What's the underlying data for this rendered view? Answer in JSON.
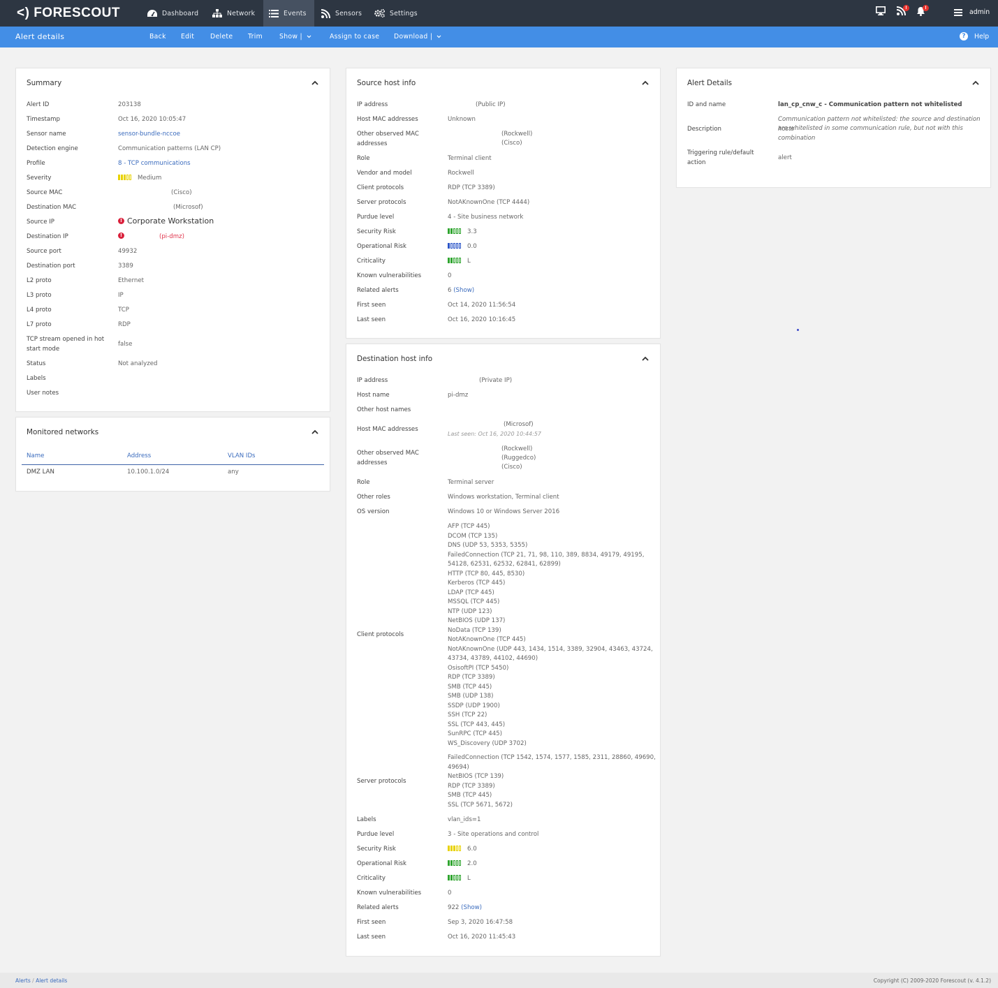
{
  "header": {
    "logo": "<) FORESCOUT",
    "nav": [
      {
        "label": "Dashboard",
        "icon": "dashboard-icon"
      },
      {
        "label": "Network",
        "icon": "network-icon"
      },
      {
        "label": "Events",
        "icon": "events-icon",
        "active": true
      },
      {
        "label": "Sensors",
        "icon": "sensors-icon"
      },
      {
        "label": "Settings",
        "icon": "settings-icon"
      }
    ],
    "user": "admin",
    "badge_1": "!",
    "badge_2": "!"
  },
  "toolbar": {
    "title": "Alert details",
    "back": "Back",
    "edit": "Edit",
    "delete": "Delete",
    "trim": "Trim",
    "show": "Show |",
    "assign": "Assign to case",
    "download": "Download |",
    "help": "Help"
  },
  "summary": {
    "title": "Summary",
    "rows": [
      {
        "label": "Alert ID",
        "value": "203138"
      },
      {
        "label": "Timestamp",
        "value": "Oct 16, 2020 10:05:47"
      },
      {
        "label": "Sensor name",
        "value": "sensor-bundle-nccoe"
      },
      {
        "label": "Detection engine",
        "value": "Communication patterns (LAN CP)"
      },
      {
        "label": "Profile",
        "value": "8 - TCP communications"
      },
      {
        "label": "Severity",
        "value": "Medium"
      },
      {
        "label": "Source MAC",
        "value": "(Cisco)"
      },
      {
        "label": "Destination MAC",
        "value": "(Microsof)"
      },
      {
        "label": "Source IP",
        "value": "Corporate Workstation"
      },
      {
        "label": "Destination IP",
        "value": "(pi-dmz)"
      },
      {
        "label": "Source port",
        "value": "49932"
      },
      {
        "label": "Destination port",
        "value": "3389"
      },
      {
        "label": "L2 proto",
        "value": "Ethernet"
      },
      {
        "label": "L3 proto",
        "value": "IP"
      },
      {
        "label": "L4 proto",
        "value": "TCP"
      },
      {
        "label": "L7 proto",
        "value": "RDP"
      },
      {
        "label": "TCP stream opened in hot start mode",
        "value": "false"
      },
      {
        "label": "Status",
        "value": "Not analyzed"
      },
      {
        "label": "Labels",
        "value": ""
      },
      {
        "label": "User notes",
        "value": ""
      }
    ]
  },
  "monitored": {
    "title": "Monitored networks",
    "col_name": "Name",
    "col_address": "Address",
    "col_vlan": "VLAN IDs",
    "rows": [
      {
        "name": "DMZ LAN",
        "address": "10.100.1.0/24",
        "vlan": "any"
      }
    ]
  },
  "source": {
    "title": "Source host info",
    "rows": [
      {
        "label": "IP address",
        "value": "(Public IP)"
      },
      {
        "label": "Host MAC addresses",
        "value": "Unknown"
      },
      {
        "label": "Other observed MAC addresses",
        "value": "(Rockwell)",
        "value2": "(Cisco)"
      },
      {
        "label": "Role",
        "value": "Terminal client"
      },
      {
        "label": "Vendor and model",
        "value": "Rockwell"
      },
      {
        "label": "Client protocols",
        "value": "RDP (TCP 3389)"
      },
      {
        "label": "Server protocols",
        "value": "NotAKnownOne (TCP 4444)"
      },
      {
        "label": "Purdue level",
        "value": "4 - Site business network"
      },
      {
        "label": "Security Risk",
        "value": "3.3"
      },
      {
        "label": "Operational Risk",
        "value": "0.0"
      },
      {
        "label": "Criticality",
        "value": "L"
      },
      {
        "label": "Known vulnerabilities",
        "value": "0"
      },
      {
        "label": "Related alerts",
        "value": "6",
        "link": "(Show)"
      },
      {
        "label": "First seen",
        "value": "Oct 14, 2020 11:56:54"
      },
      {
        "label": "Last seen",
        "value": "Oct 16, 2020 10:16:45"
      }
    ]
  },
  "destination": {
    "title": "Destination host info",
    "rows": [
      {
        "label": "IP address",
        "value": "(Private IP)"
      },
      {
        "label": "Host name",
        "value": "pi-dmz"
      },
      {
        "label": "Other host names",
        "value": ""
      },
      {
        "label": "Host MAC addresses",
        "value": "(Microsof)",
        "note": "Last seen: Oct 16, 2020 10:44:57"
      },
      {
        "label": "Other observed MAC addresses",
        "lines": [
          "(Rockwell)",
          "(Ruggedco)",
          "(Cisco)"
        ]
      },
      {
        "label": "Role",
        "value": "Terminal server"
      },
      {
        "label": "Other roles",
        "value": "Windows workstation, Terminal client"
      },
      {
        "label": "OS version",
        "value": "Windows 10 or Windows Server 2016"
      },
      {
        "label": "Client protocols",
        "lines": [
          "AFP (TCP 445)",
          "DCOM (TCP 135)",
          "DNS (UDP 53, 5353, 5355)",
          "FailedConnection (TCP 21, 71, 98, 110, 389, 8834, 49179, 49195,",
          "54128, 62531, 62532, 62841, 62899)",
          "HTTP (TCP 80, 445, 8530)",
          "Kerberos (TCP 445)",
          "LDAP (TCP 445)",
          "MSSQL (TCP 445)",
          "NTP (UDP 123)",
          "NetBIOS (UDP 137)",
          "NoData (TCP 139)",
          "NotAKnownOne (TCP 445)",
          "NotAKnownOne (UDP 443, 1434, 1514, 3389, 32904, 43463, 43724,",
          "43734, 43789, 44102, 44690)",
          "OsisoftPI (TCP 5450)",
          "RDP (TCP 3389)",
          "SMB (TCP 445)",
          "SMB (UDP 138)",
          "SSDP (UDP 1900)",
          "SSH (TCP 22)",
          "SSL (TCP 443, 445)",
          "SunRPC (TCP 445)",
          "WS_Discovery (UDP 3702)"
        ]
      },
      {
        "label": "Server protocols",
        "lines": [
          "FailedConnection (TCP 1542, 1574, 1577, 1585, 2311, 28860, 49690,",
          "49694)",
          "NetBIOS (TCP 139)",
          "RDP (TCP 3389)",
          "SMB (TCP 445)",
          "SSL (TCP 5671, 5672)"
        ]
      },
      {
        "label": "Labels",
        "value": "vlan_ids=1"
      },
      {
        "label": "Purdue level",
        "value": "3 - Site operations and control"
      },
      {
        "label": "Security Risk",
        "value": "6.0"
      },
      {
        "label": "Operational Risk",
        "value": "2.0"
      },
      {
        "label": "Criticality",
        "value": "L"
      },
      {
        "label": "Known vulnerabilities",
        "value": "0"
      },
      {
        "label": "Related alerts",
        "value": "922",
        "link": "(Show)"
      },
      {
        "label": "First seen",
        "value": "Sep 3, 2020 16:47:58"
      },
      {
        "label": "Last seen",
        "value": "Oct 16, 2020 11:45:43"
      }
    ]
  },
  "alert": {
    "title": "Alert Details",
    "rows": [
      {
        "label": "ID and name",
        "value": "lan_cp_cnw_c - Communication pattern not whitelisted"
      },
      {
        "label": "Description",
        "lines": [
          "Communication pattern not whitelisted: the source and destination hosts",
          "are whitelisted in some communication rule, but not with this",
          "combination"
        ]
      },
      {
        "label": "Triggering rule/default action",
        "value": "alert"
      }
    ]
  },
  "footer": {
    "breadcrumb_1": "Alerts",
    "breadcrumb_sep": "/",
    "breadcrumb_2": "Alert details",
    "copyright": "Copyright (C) 2009-2020 Forescout (v. 4.1.2)"
  },
  "colors": {
    "topbar": "#2d3642",
    "toolbar": "#438ee6",
    "link": "#3a6bbd",
    "red": "#e0334b",
    "bar_yellow": "#e8d200",
    "bar_green": "#2fa52f",
    "bar_blue": "#2b55c8"
  }
}
